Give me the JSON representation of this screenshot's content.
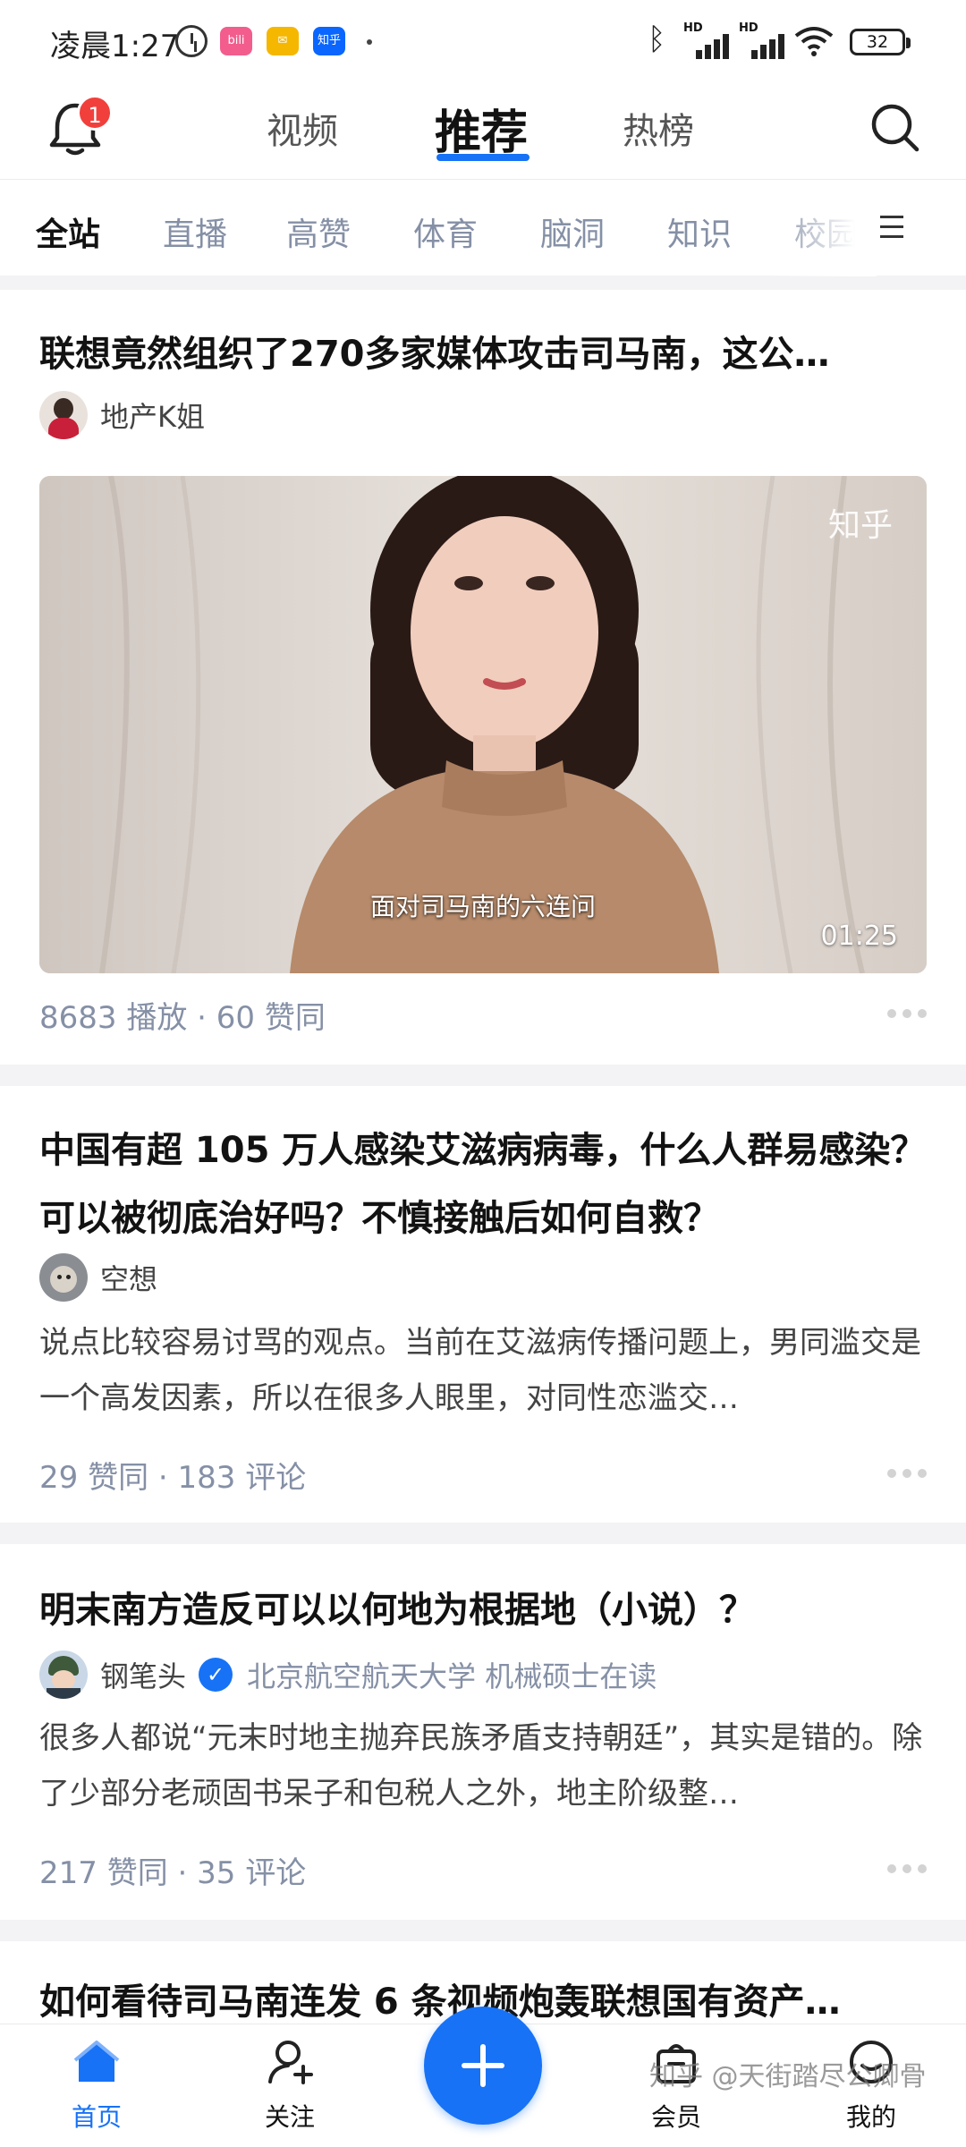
{
  "status_bar": {
    "time": "凌晨1:27",
    "app_icons": [
      "bilibili-icon",
      "mail-icon",
      "zhihu-icon"
    ],
    "zhihu_label": "知乎",
    "bili_label": "bili",
    "hd_label": "HD",
    "battery": "32"
  },
  "top_nav": {
    "notification_count": "1",
    "tabs": [
      "视频",
      "推荐",
      "热榜"
    ],
    "active_tab": "推荐"
  },
  "categories": [
    "全站",
    "直播",
    "高赞",
    "体育",
    "脑洞",
    "知识",
    "校园"
  ],
  "active_category": "全站",
  "feed": [
    {
      "type": "video",
      "title": "联想竟然组织了270多家媒体攻击司马南，这公…",
      "author": "地产K姐",
      "video": {
        "watermark": "知乎",
        "caption": "面对司马南的六连问",
        "duration": "01:25"
      },
      "meta": "8683 播放 · 60 赞同"
    },
    {
      "type": "answer",
      "title": "中国有超 105 万人感染艾滋病病毒，什么人群易感染？可以被彻底治好吗？不慎接触后如何自救？",
      "author": "空想",
      "excerpt": "说点比较容易讨骂的观点。当前在艾滋病传播问题上，男同滥交是一个高发因素，所以在很多人眼里，对同性恋滥交…",
      "meta": "29 赞同 · 183 评论"
    },
    {
      "type": "answer",
      "title": "明末南方造反可以以何地为根据地（小说）？",
      "author": "钢笔头",
      "author_desc": "北京航空航天大学 机械硕士在读",
      "excerpt": "很多人都说“元末时地主抛弃民族矛盾支持朝廷”，其实是错的。除了少部分老顽固书呆子和包税人之外，地主阶级整…",
      "meta": "217 赞同 · 35 评论"
    },
    {
      "type": "answer",
      "title": "如何看待司马南连发 6 条视频炮轰联想国有资产…"
    }
  ],
  "bottom_nav": {
    "items": [
      "首页",
      "关注",
      "会员",
      "我的"
    ],
    "active": "首页"
  },
  "watermark": "知乎 @天街踏尽公卿骨",
  "colors": {
    "accent": "#1772f6",
    "badge": "#f1403c",
    "muted": "#8590a6"
  }
}
